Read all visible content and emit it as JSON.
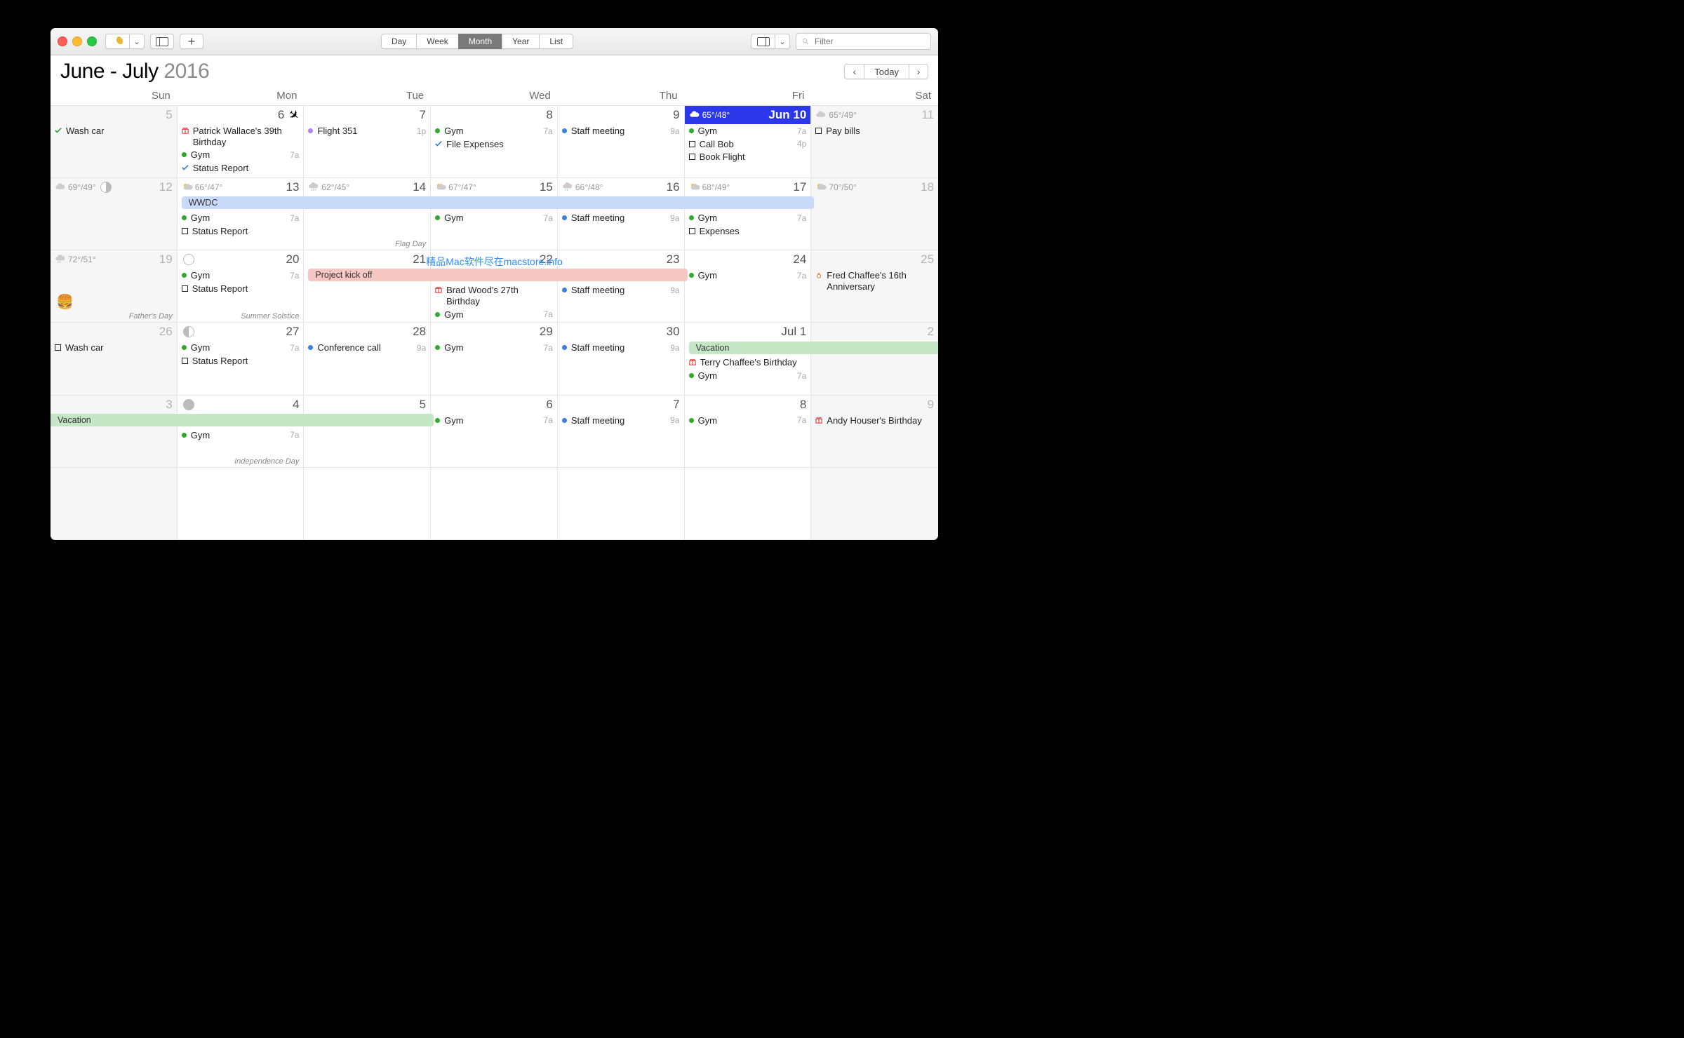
{
  "toolbar": {
    "views": [
      "Day",
      "Week",
      "Month",
      "Year",
      "List"
    ],
    "active_view": "Month",
    "search_placeholder": "Filter"
  },
  "header": {
    "title_prefix": "June - July ",
    "year": "2016",
    "today_label": "Today"
  },
  "watermark": "精品Mac软件尽在macstore.info",
  "dow": [
    "Sun",
    "Mon",
    "Tue",
    "Wed",
    "Thu",
    "Fri",
    "Sat"
  ],
  "footers": {
    "flag_day": "Flag Day",
    "fathers_day": "Father's Day",
    "summer_solstice": "Summer Solstice",
    "independence_day": "Independence Day"
  },
  "spans": {
    "wwdc": "WWDC",
    "project_kickoff": "Project kick off",
    "vacation": "Vacation"
  },
  "days": {
    "r0": [
      {
        "num": "5"
      },
      {
        "num": "6",
        "flight": true
      },
      {
        "num": "7"
      },
      {
        "num": "8"
      },
      {
        "num": "9"
      },
      {
        "num": "Jun 10",
        "weather": "65°/48°",
        "today": true
      },
      {
        "num": "11",
        "weather": "65°/49°"
      }
    ],
    "r1": [
      {
        "num": "12",
        "weather": "69°/49°",
        "moon": "first"
      },
      {
        "num": "13",
        "weather": "66°/47°"
      },
      {
        "num": "14",
        "weather": "62°/45°"
      },
      {
        "num": "15",
        "weather": "67°/47°"
      },
      {
        "num": "16",
        "weather": "66°/48°"
      },
      {
        "num": "17",
        "weather": "68°/49°"
      },
      {
        "num": "18",
        "weather": "70°/50°"
      }
    ],
    "r2": [
      {
        "num": "19",
        "weather": "72°/51°"
      },
      {
        "num": "20",
        "moon": "new"
      },
      {
        "num": "21"
      },
      {
        "num": "22"
      },
      {
        "num": "23"
      },
      {
        "num": "24"
      },
      {
        "num": "25"
      }
    ],
    "r3": [
      {
        "num": "26"
      },
      {
        "num": "27",
        "moon": "last"
      },
      {
        "num": "28"
      },
      {
        "num": "29"
      },
      {
        "num": "30"
      },
      {
        "num": "Jul 1"
      },
      {
        "num": "2"
      }
    ],
    "r4": [
      {
        "num": "3"
      },
      {
        "num": "4",
        "moon": "full"
      },
      {
        "num": "5"
      },
      {
        "num": "6"
      },
      {
        "num": "7"
      },
      {
        "num": "8"
      },
      {
        "num": "9"
      }
    ]
  },
  "events": {
    "jun5": [
      {
        "icon": "check-green",
        "label": "Wash car"
      }
    ],
    "jun6": [
      {
        "icon": "gift",
        "label": "Patrick Wallace's 39th Birthday"
      },
      {
        "icon": "dot-green",
        "label": "Gym",
        "time": "7a"
      },
      {
        "icon": "check-blue",
        "label": "Status Report"
      }
    ],
    "jun7": [
      {
        "icon": "dot-violet",
        "label": "Flight 351",
        "time": "1p"
      }
    ],
    "jun8": [
      {
        "icon": "dot-green",
        "label": "Gym",
        "time": "7a"
      },
      {
        "icon": "check-blue",
        "label": "File Expenses"
      }
    ],
    "jun9": [
      {
        "icon": "dot-blue",
        "label": "Staff meeting",
        "time": "9a"
      }
    ],
    "jun10": [
      {
        "icon": "dot-green",
        "label": "Gym",
        "time": "7a"
      },
      {
        "icon": "sq-blue",
        "label": "Call Bob",
        "time": "4p"
      },
      {
        "icon": "sq-red",
        "label": "Book Flight"
      }
    ],
    "jun11": [
      {
        "icon": "sq-green",
        "label": "Pay bills"
      }
    ],
    "jun13": [
      {
        "icon": "dot-green",
        "label": "Gym",
        "time": "7a"
      },
      {
        "icon": "sq-blue",
        "label": "Status Report"
      }
    ],
    "jun15": [
      {
        "icon": "dot-green",
        "label": "Gym",
        "time": "7a"
      }
    ],
    "jun16": [
      {
        "icon": "dot-blue",
        "label": "Staff meeting",
        "time": "9a"
      }
    ],
    "jun17": [
      {
        "icon": "dot-green",
        "label": "Gym",
        "time": "7a"
      },
      {
        "icon": "sq-red",
        "label": "Expenses"
      }
    ],
    "jun20": [
      {
        "icon": "dot-green",
        "label": "Gym",
        "time": "7a"
      },
      {
        "icon": "sq-blue",
        "label": "Status Report"
      }
    ],
    "jun22": [
      {
        "icon": "gift",
        "label": "Brad Wood's 27th Birthday"
      },
      {
        "icon": "dot-green",
        "label": "Gym",
        "time": "7a"
      }
    ],
    "jun23": [
      {
        "icon": "dot-blue",
        "label": "Staff meeting",
        "time": "9a"
      }
    ],
    "jun24": [
      {
        "icon": "dot-green",
        "label": "Gym",
        "time": "7a"
      }
    ],
    "jun25": [
      {
        "icon": "ring",
        "label": "Fred Chaffee's 16th Anniversary"
      }
    ],
    "jun26": [
      {
        "icon": "sq-green",
        "label": "Wash car"
      }
    ],
    "jun27": [
      {
        "icon": "dot-green",
        "label": "Gym",
        "time": "7a"
      },
      {
        "icon": "sq-blue",
        "label": "Status Report"
      }
    ],
    "jun28": [
      {
        "icon": "dot-blue",
        "label": "Conference call",
        "time": "9a"
      }
    ],
    "jun29": [
      {
        "icon": "dot-green",
        "label": "Gym",
        "time": "7a"
      }
    ],
    "jun30": [
      {
        "icon": "dot-blue",
        "label": "Staff meeting",
        "time": "9a"
      }
    ],
    "jul1": [
      {
        "icon": "gift",
        "label": "Terry Chaffee's Birth­day"
      },
      {
        "icon": "dot-green",
        "label": "Gym",
        "time": "7a"
      }
    ],
    "jul4": [
      {
        "icon": "dot-green",
        "label": "Gym",
        "time": "7a"
      }
    ],
    "jul6": [
      {
        "icon": "dot-green",
        "label": "Gym",
        "time": "7a"
      }
    ],
    "jul7": [
      {
        "icon": "dot-blue",
        "label": "Staff meeting",
        "time": "9a"
      }
    ],
    "jul8": [
      {
        "icon": "dot-green",
        "label": "Gym",
        "time": "7a"
      }
    ],
    "jul9": [
      {
        "icon": "gift",
        "label": "Andy Houser's Birthday"
      }
    ]
  }
}
